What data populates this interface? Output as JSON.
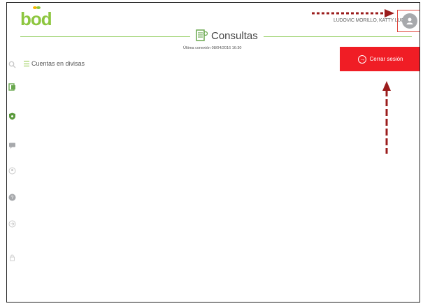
{
  "brand": {
    "logo_text": "bod",
    "accent_color": "#8dc63f"
  },
  "header": {
    "title": "Consultas",
    "last_connection": "Última conexión 08/04/2016 16:30",
    "user_name": "LUDOVIC MORILLO, KATTY LUCIA"
  },
  "actions": {
    "logout_label": "Cerrar sesión",
    "logout_color": "#f01d25"
  },
  "sidebar": {
    "items": [
      {
        "icon": "search-icon"
      },
      {
        "icon": "document-icon"
      },
      {
        "icon": "shield-icon"
      },
      {
        "icon": "chat-icon"
      },
      {
        "icon": "contact-icon"
      },
      {
        "icon": "help-icon"
      },
      {
        "icon": "logout-icon"
      },
      {
        "icon": "lock-icon"
      }
    ]
  },
  "menu": {
    "items": [
      {
        "label": "Cuentas en divisas"
      }
    ]
  },
  "annotations": {
    "arrow_color": "#9b1c1c"
  }
}
